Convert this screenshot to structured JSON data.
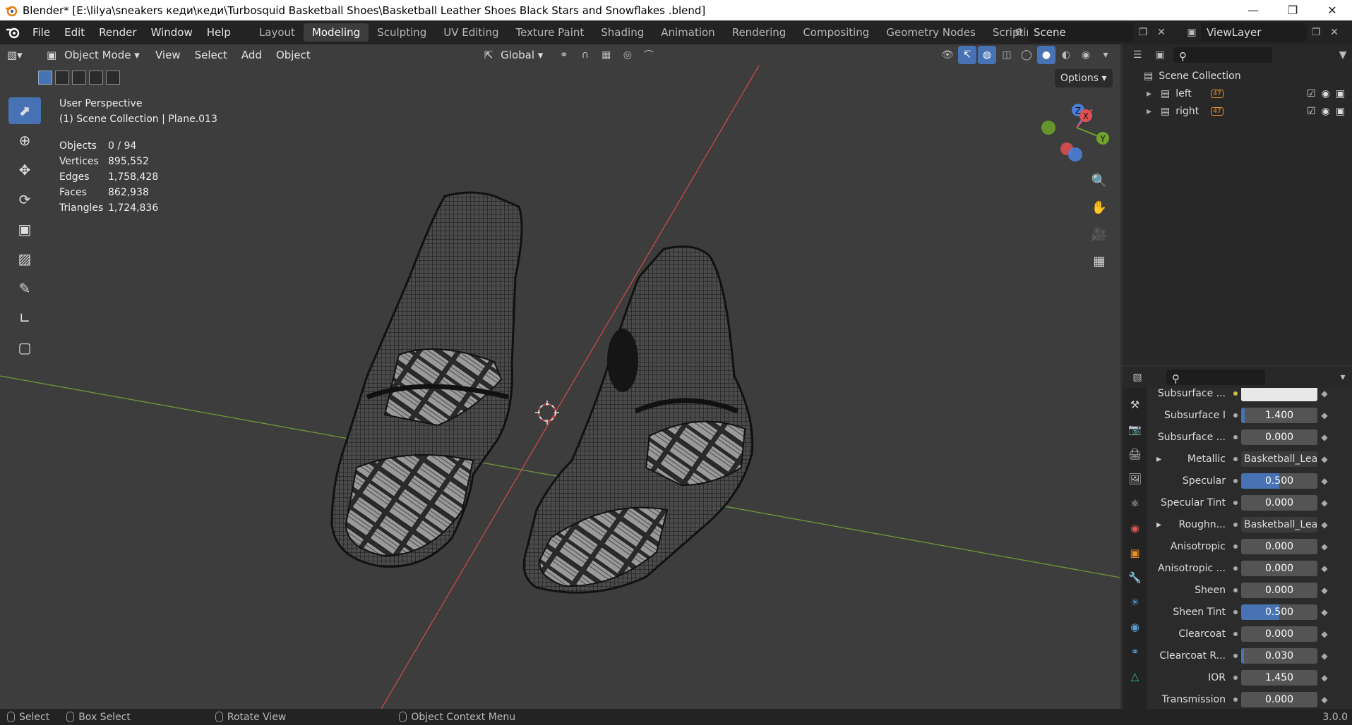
{
  "window": {
    "title": "Blender* [E:\\lilya\\sneakers кеди\\кеди\\Turbosquid Basketball Shoes\\Basketball Leather Shoes Black Stars and Snowflakes .blend]"
  },
  "menu": [
    "File",
    "Edit",
    "Render",
    "Window",
    "Help"
  ],
  "workspaces": [
    {
      "label": "Layout",
      "active": false
    },
    {
      "label": "Modeling",
      "active": true
    },
    {
      "label": "Sculpting",
      "active": false
    },
    {
      "label": "UV Editing",
      "active": false
    },
    {
      "label": "Texture Paint",
      "active": false
    },
    {
      "label": "Shading",
      "active": false
    },
    {
      "label": "Animation",
      "active": false
    },
    {
      "label": "Rendering",
      "active": false
    },
    {
      "label": "Compositing",
      "active": false
    },
    {
      "label": "Geometry Nodes",
      "active": false
    },
    {
      "label": "Scripting",
      "active": false
    }
  ],
  "scene": {
    "name": "Scene",
    "view_layer": "ViewLayer"
  },
  "viewport_header": {
    "mode": "Object Mode",
    "menus": [
      "View",
      "Select",
      "Add",
      "Object"
    ],
    "orientation": "Global",
    "options": "Options"
  },
  "viewport": {
    "perspective": "User Perspective",
    "collection_info": "(1) Scene Collection | Plane.013",
    "stats": [
      {
        "label": "Objects",
        "value": "0 / 94"
      },
      {
        "label": "Vertices",
        "value": "895,552"
      },
      {
        "label": "Edges",
        "value": "1,758,428"
      },
      {
        "label": "Faces",
        "value": "862,938"
      },
      {
        "label": "Triangles",
        "value": "1,724,836"
      }
    ],
    "gizmo_axes": [
      "X",
      "Y",
      "Z"
    ]
  },
  "outliner": {
    "root": "Scene Collection",
    "items": [
      {
        "label": "left",
        "badge": "47"
      },
      {
        "label": "right",
        "badge": "47"
      }
    ]
  },
  "properties": [
    {
      "label": "Subsurface ...",
      "type": "color"
    },
    {
      "label": "Subsurface I",
      "value": "1.400",
      "fill": 0.05
    },
    {
      "label": "Subsurface ...",
      "value": "0.000",
      "fill": 0
    },
    {
      "label": "Metallic",
      "value": "Basketball_Lea...",
      "type": "link"
    },
    {
      "label": "Specular",
      "value": "0.500",
      "fill": 0.5
    },
    {
      "label": "Specular Tint",
      "value": "0.000",
      "fill": 0
    },
    {
      "label": "Roughn...",
      "value": "Basketball_Lea...",
      "type": "link"
    },
    {
      "label": "Anisotropic",
      "value": "0.000",
      "fill": 0
    },
    {
      "label": "Anisotropic ...",
      "value": "0.000",
      "fill": 0
    },
    {
      "label": "Sheen",
      "value": "0.000",
      "fill": 0
    },
    {
      "label": "Sheen Tint",
      "value": "0.500",
      "fill": 0.5
    },
    {
      "label": "Clearcoat",
      "value": "0.000",
      "fill": 0
    },
    {
      "label": "Clearcoat R...",
      "value": "0.030",
      "fill": 0.03
    },
    {
      "label": "IOR",
      "value": "1.450",
      "fill": 0
    },
    {
      "label": "Transmission",
      "value": "0.000",
      "fill": 0
    }
  ],
  "statusbar": {
    "select": "Select",
    "box_select": "Box Select",
    "rotate_view": "Rotate View",
    "context_menu": "Object Context Menu",
    "version": "3.0.0"
  },
  "colors": {
    "accent": "#4772b3",
    "x_axis": "#e05050",
    "y_axis": "#6fa52a",
    "z_axis": "#4a7ed8"
  }
}
